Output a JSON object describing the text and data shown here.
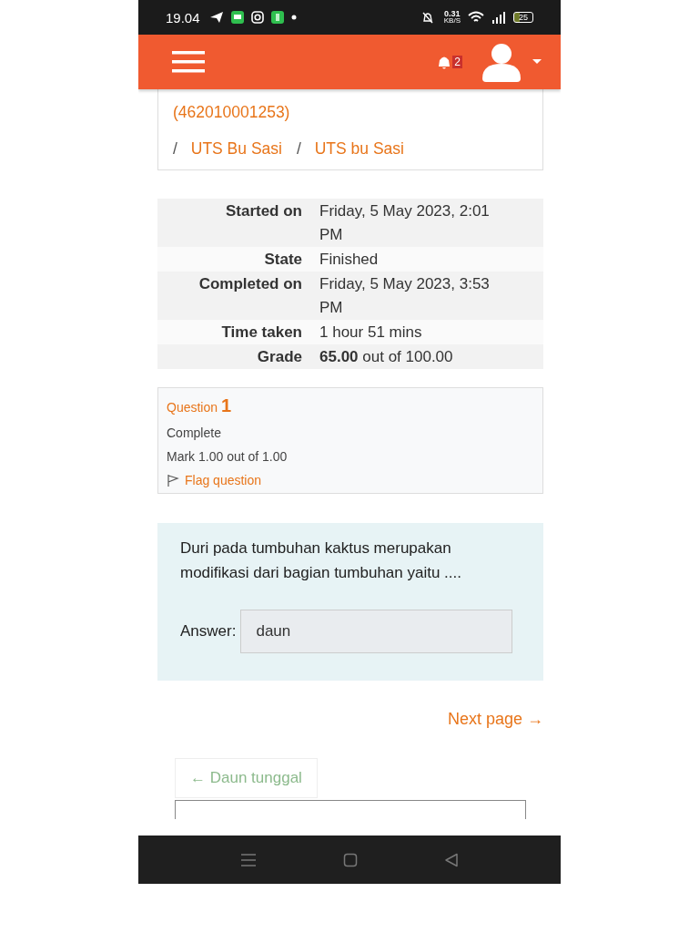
{
  "status_bar": {
    "time": "19.04",
    "network_speed": "0.31",
    "network_unit": "KB/S",
    "battery": "25"
  },
  "header": {
    "notification_count": "2"
  },
  "breadcrumb": [
    {
      "label": "(462010001253)"
    },
    {
      "separator": "/",
      "label": "UTS Bu Sasi"
    },
    {
      "separator": "/",
      "label": "UTS bu Sasi"
    }
  ],
  "summary": [
    {
      "label": "Started on",
      "value": "Friday, 5 May 2023, 2:01 PM"
    },
    {
      "label": "State",
      "value": "Finished"
    },
    {
      "label": "Completed on",
      "value": "Friday, 5 May 2023, 3:53 PM"
    },
    {
      "label": "Time taken",
      "value": "1 hour 51 mins"
    },
    {
      "label": "Grade",
      "value": "**65.00** out of 100.00"
    }
  ],
  "question": {
    "label": "Question",
    "number": "1",
    "state": "Complete",
    "mark": "Mark 1.00 out of 1.00",
    "flag_label": "Flag question",
    "flagged": false
  },
  "formulation": {
    "text": "Duri pada tumbuhan kaktus merupakan modifikasi dari bagian tumbuhan yaitu ....",
    "answer_label": "Answer:",
    "answer": "daun"
  },
  "next_link": "Next page →",
  "prev_button": "← Daun tunggal"
}
